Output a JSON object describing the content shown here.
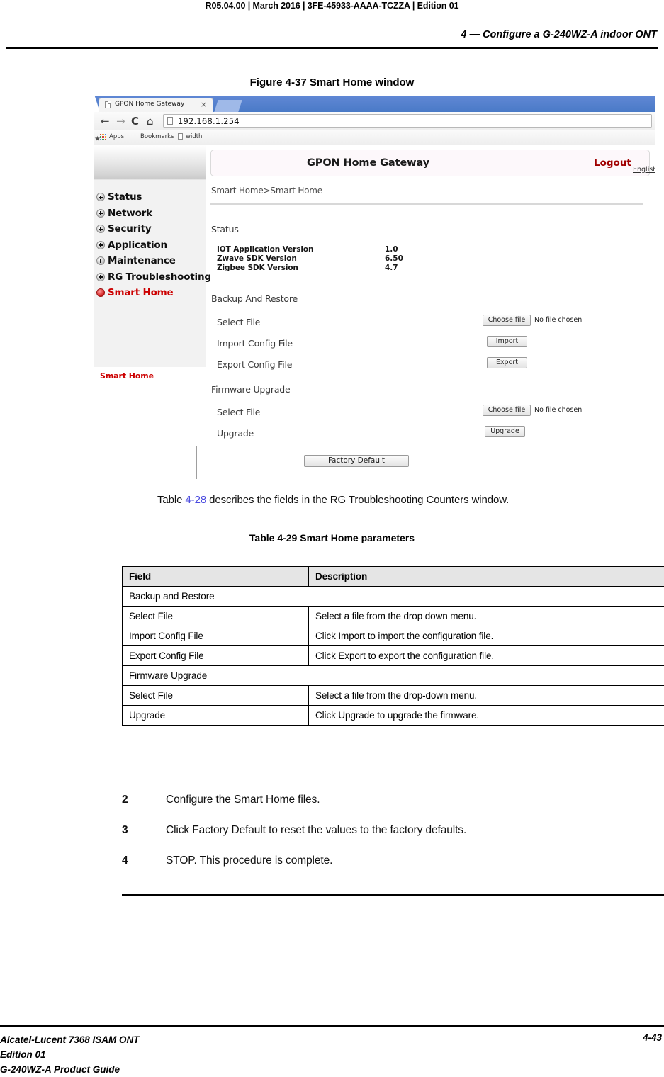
{
  "page_header": {
    "doc_id": "R05.04.00 | March 2016 | 3FE-45933-AAAA-TCZZA | Edition 01",
    "chapter": "4 —  Configure a G-240WZ-A indoor ONT"
  },
  "figure": {
    "caption": "Figure 4-37  Smart Home window",
    "browser": {
      "tab_title": "GPON Home Gateway",
      "tab_close": "×",
      "nav": {
        "back": "←",
        "forward": "→",
        "reload": "C",
        "home": "⌂"
      },
      "url": "192.168.1.254",
      "bookmarks": [
        "Apps",
        "Bookmarks",
        "width"
      ]
    },
    "app": {
      "header_title": "GPON Home Gateway",
      "logout": "Logout",
      "language": "English |Español",
      "breadcrumb": "Smart Home>Smart Home",
      "sidebar": {
        "items": [
          {
            "label": "Status",
            "icon": "plus-icon",
            "active": false
          },
          {
            "label": "Network",
            "icon": "plus-icon",
            "active": false
          },
          {
            "label": "Security",
            "icon": "plus-icon",
            "active": false
          },
          {
            "label": "Application",
            "icon": "plus-icon",
            "active": false
          },
          {
            "label": "Maintenance",
            "icon": "plus-icon",
            "active": false
          },
          {
            "label": "RG Troubleshooting",
            "icon": "plus-icon",
            "active": false
          },
          {
            "label": "Smart Home",
            "icon": "minus-icon",
            "active": true
          }
        ],
        "subitem": "Smart Home"
      },
      "status_section": {
        "title": "Status",
        "rows": [
          {
            "label": "IOT Application Version",
            "value": "1.0"
          },
          {
            "label": "Zwave SDK Version",
            "value": "6.50"
          },
          {
            "label": "Zigbee SDK Version",
            "value": "4.7"
          }
        ]
      },
      "backup_section": {
        "title": "Backup And Restore",
        "select_file_label": "Select File",
        "choose_file_button": "Choose file",
        "no_file_text": "No file chosen",
        "import_label": "Import Config File",
        "import_button": "Import",
        "export_label": "Export Config File",
        "export_button": "Export"
      },
      "firmware_section": {
        "title": "Firmware Upgrade",
        "select_file_label": "Select File",
        "choose_file_button": "Choose file",
        "no_file_text": "No file chosen",
        "upgrade_label": "Upgrade",
        "upgrade_button": "Upgrade"
      },
      "factory_default_button": "Factory Default"
    }
  },
  "body": {
    "table_ref_prefix": "Table ",
    "table_ref_link": "4-28",
    "table_ref_suffix": " describes the fields in the RG Troubleshooting Counters window.",
    "table_caption": "Table 4-29 Smart Home parameters"
  },
  "table": {
    "headers": [
      "Field",
      "Description"
    ],
    "rows": [
      {
        "type": "group",
        "field": "Backup and Restore",
        "description": ""
      },
      {
        "type": "data",
        "field": "Select File",
        "description": "Select a file from the drop down menu."
      },
      {
        "type": "data",
        "field": "Import Config File",
        "description": "Click Import to import the configuration file."
      },
      {
        "type": "data",
        "field": "Export Config File",
        "description": "Click Export to export the configuration file."
      },
      {
        "type": "group",
        "field": "Firmware Upgrade",
        "description": ""
      },
      {
        "type": "data",
        "field": "Select File",
        "description": "Select a file from the drop-down menu."
      },
      {
        "type": "data",
        "field": "Upgrade",
        "description": "Click Upgrade to upgrade the firmware."
      }
    ]
  },
  "steps": [
    {
      "num": "2",
      "text": "Configure the Smart Home files."
    },
    {
      "num": "3",
      "text": "Click Factory Default to reset the values to the factory defaults."
    },
    {
      "num": "4",
      "text": "STOP. This procedure is complete."
    }
  ],
  "footer": {
    "line1": "Alcatel-Lucent 7368 ISAM ONT",
    "line2": "Edition 01",
    "line3": "G-240WZ-A Product Guide",
    "page": "4-43"
  }
}
